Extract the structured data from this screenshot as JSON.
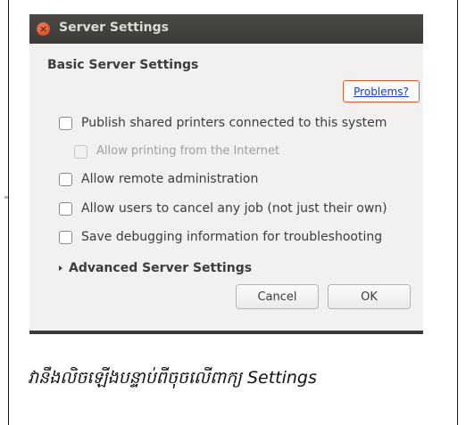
{
  "window": {
    "title": "Server Settings",
    "section_heading": "Basic Server Settings",
    "problems_link": "Problems?",
    "options": [
      {
        "label": "Publish shared printers connected to this system",
        "checked": false,
        "enabled": true
      },
      {
        "label": "Allow printing from the Internet",
        "checked": false,
        "enabled": false
      },
      {
        "label": "Allow remote administration",
        "checked": false,
        "enabled": true
      },
      {
        "label": "Allow users to cancel any job (not just their own)",
        "checked": false,
        "enabled": true
      },
      {
        "label": "Save debugging information for troubleshooting",
        "checked": false,
        "enabled": true
      }
    ],
    "advanced_expander": "Advanced Server Settings",
    "cancel_label": "Cancel",
    "ok_label": "OK"
  },
  "caption": "វានឹងលិចឡើងបន្ទាប់ពីចុចលើពាក្យ Settings",
  "colors": {
    "titlebar": "#3c3b37",
    "dialog_bg": "#f2f1f0",
    "close_button": "#e0532a",
    "link": "#1a3fb4",
    "problems_border": "#e25a2b"
  }
}
